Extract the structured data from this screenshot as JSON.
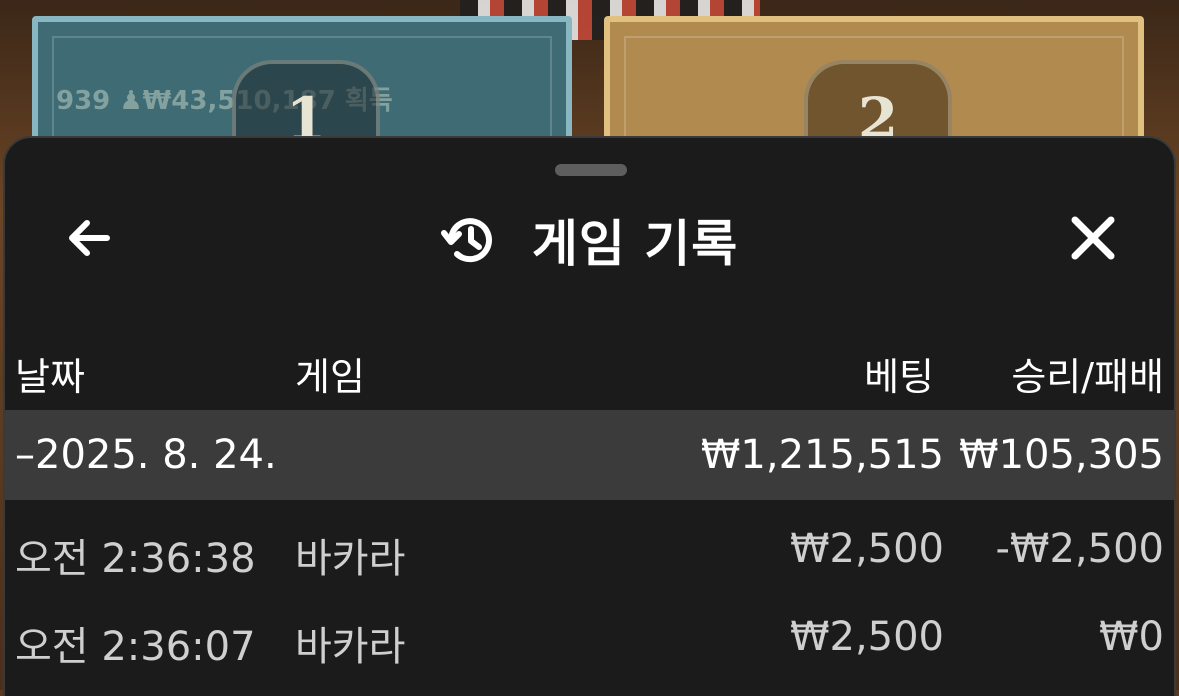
{
  "background": {
    "left_card_number": "1",
    "right_card_number": "2",
    "left_card_ticker": "939 ♟₩43,510,187 획득"
  },
  "header": {
    "title": "게임 기록",
    "back_icon": "arrow-left-icon",
    "history_icon": "history-clock-icon",
    "close_icon": "close-icon"
  },
  "columns": {
    "date": "날짜",
    "game": "게임",
    "bet": "베팅",
    "result": "승리/패배"
  },
  "day_summary": {
    "date": "–2025. 8. 24.",
    "bet_total": "₩1,215,515",
    "result_total": "₩105,305"
  },
  "rows": [
    {
      "time": "오전 2:36:38",
      "game": "바카라",
      "bet": "₩2,500",
      "result": "-₩2,500"
    },
    {
      "time": "오전 2:36:07",
      "game": "바카라",
      "bet": "₩2,500",
      "result": "₩0"
    }
  ],
  "colors": {
    "sheet_bg": "#1b1b1b",
    "summary_bg": "#3b3b3b",
    "text_primary": "#ffffff",
    "text_secondary": "#cfcfcf"
  }
}
